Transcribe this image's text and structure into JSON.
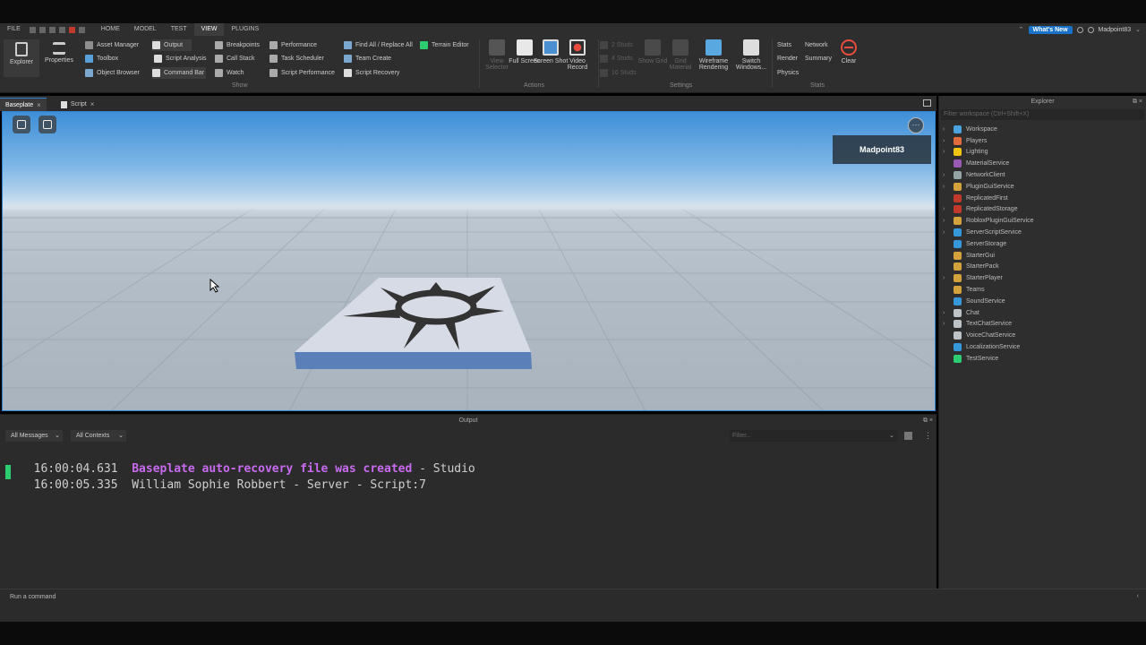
{
  "menu": {
    "file": "FILE",
    "tabs": [
      "HOME",
      "MODEL",
      "TEST",
      "VIEW",
      "PLUGINS"
    ],
    "active_tab": "VIEW",
    "whats_new": "What's New",
    "user": "Madpoint83"
  },
  "ribbon": {
    "explorer": "Explorer",
    "properties": "Properties",
    "show_col1": [
      "Asset Manager",
      "Toolbox",
      "Object Browser"
    ],
    "show_col2": [
      "Output",
      "Script Analysis",
      "Command Bar"
    ],
    "show_col3": [
      "Breakpoints",
      "Call Stack",
      "Watch"
    ],
    "show_col4": [
      "Performance",
      "Task Scheduler",
      "Script Performance"
    ],
    "show_col5": [
      "Find All / Replace All",
      "Team Create",
      "Script Recovery"
    ],
    "terrain_editor": "Terrain Editor",
    "show_label": "Show",
    "view_selector": "View Selector",
    "full_screen": "Full Screen",
    "screen_shot": "Screen Shot",
    "video_record": "Video Record",
    "actions_label": "Actions",
    "studs": [
      "2 Studs",
      "4 Studs",
      "16 Studs"
    ],
    "show_grid": "Show Grid",
    "grid_material": "Grid Material",
    "wireframe_rendering": "Wireframe Rendering",
    "switch_windows": "Switch Windows...",
    "settings_label": "Settings",
    "stats_col1": [
      "Stats",
      "Render",
      "Physics"
    ],
    "stats_col2": [
      "Network",
      "Summary"
    ],
    "clear": "Clear",
    "stats_label": "Stats"
  },
  "tabs": [
    {
      "label": "Baseplate",
      "close": "×"
    },
    {
      "label": "Script",
      "close": "×"
    }
  ],
  "viewport": {
    "player_name": "Madpoint83",
    "chat_glyph": "···"
  },
  "explorer": {
    "title": "Explorer",
    "controls": "⧉ ×",
    "filter_placeholder": "Filter workspace (Ctrl+Shift+X)",
    "items": [
      {
        "label": "Workspace",
        "arrow": "›",
        "color": "#4aa3df"
      },
      {
        "label": "Players",
        "arrow": "›",
        "color": "#e06c3c"
      },
      {
        "label": "Lighting",
        "arrow": "›",
        "color": "#f1c40f"
      },
      {
        "label": "MaterialService",
        "arrow": "",
        "color": "#9b59b6"
      },
      {
        "label": "NetworkClient",
        "arrow": "›",
        "color": "#95a5a6"
      },
      {
        "label": "PluginGuiService",
        "arrow": "›",
        "color": "#d4a23c"
      },
      {
        "label": "ReplicatedFirst",
        "arrow": "",
        "color": "#c0392b"
      },
      {
        "label": "ReplicatedStorage",
        "arrow": "›",
        "color": "#c0392b"
      },
      {
        "label": "RobloxPluginGuiService",
        "arrow": "›",
        "color": "#d4a23c"
      },
      {
        "label": "ServerScriptService",
        "arrow": "›",
        "color": "#3498db"
      },
      {
        "label": "ServerStorage",
        "arrow": "",
        "color": "#3498db"
      },
      {
        "label": "StarterGui",
        "arrow": "",
        "color": "#d4a23c"
      },
      {
        "label": "StarterPack",
        "arrow": "",
        "color": "#d4a23c"
      },
      {
        "label": "StarterPlayer",
        "arrow": "›",
        "color": "#d4a23c"
      },
      {
        "label": "Teams",
        "arrow": "",
        "color": "#d4a23c"
      },
      {
        "label": "SoundService",
        "arrow": "",
        "color": "#3498db"
      },
      {
        "label": "Chat",
        "arrow": "›",
        "color": "#bdc3c7"
      },
      {
        "label": "TextChatService",
        "arrow": "›",
        "color": "#bdc3c7"
      },
      {
        "label": "VoiceChatService",
        "arrow": "",
        "color": "#bdc3c7"
      },
      {
        "label": "LocalizationService",
        "arrow": "",
        "color": "#3498db"
      },
      {
        "label": "TestService",
        "arrow": "",
        "color": "#2ecc71"
      }
    ]
  },
  "output": {
    "title": "Output",
    "controls": "⧉ ×",
    "messages_dd": "All Messages",
    "contexts_dd": "All Contexts",
    "dd_arrow": "⌄",
    "filter_placeholder": "Filter...",
    "more": "⋮",
    "lines": [
      {
        "time": "16:00:04.631",
        "message": "Baseplate auto-recovery file was created",
        "sep": " - ",
        "source": "Studio",
        "msg_color": "#c86af0",
        "bold": true
      },
      {
        "time": "16:00:05.335",
        "message": "William Sophie Robbert",
        "sep": " - ",
        "source": "Server - Script:7",
        "msg_color": "#cfcfcf",
        "bold": false
      }
    ]
  },
  "command": {
    "placeholder": "Run a command",
    "arrow": "‹"
  }
}
